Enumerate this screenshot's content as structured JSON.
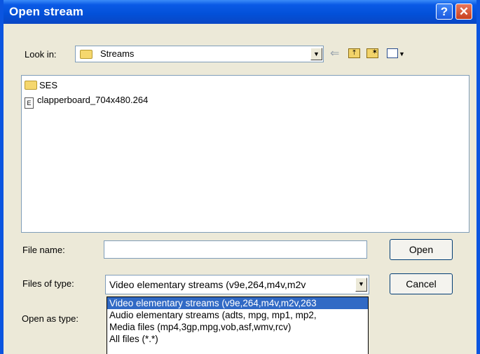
{
  "window": {
    "title": "Open stream",
    "help_label": "?",
    "close_label": "✕"
  },
  "look_in": {
    "label": "Look in:",
    "value": "Streams"
  },
  "toolbar": {
    "icons": [
      "back-icon",
      "up-folder-icon",
      "new-folder-icon",
      "view-menu-icon"
    ]
  },
  "files": [
    {
      "name": "SES",
      "type": "folder"
    },
    {
      "name": "clapperboard_704x480.264",
      "type": "file"
    }
  ],
  "file_name": {
    "label": "File name:",
    "value": ""
  },
  "files_of_type": {
    "label": "Files of type:",
    "selected": "Video elementary streams (v9e,264,m4v,m2v"
  },
  "open_as_type": {
    "label": "Open as type:"
  },
  "buttons": {
    "open": "Open",
    "cancel": "Cancel"
  },
  "type_options": [
    "Video elementary streams (v9e,264,m4v,m2v,263",
    "Audio elementary streams (adts, mpg, mp1, mp2,",
    "Media files (mp4,3gp,mpg,vob,asf,wmv,rcv)",
    "All files (*.*)"
  ],
  "colors": {
    "title_bar": "#0a5ae6",
    "selection": "#316ac5",
    "dialog_bg": "#ece9d8"
  }
}
